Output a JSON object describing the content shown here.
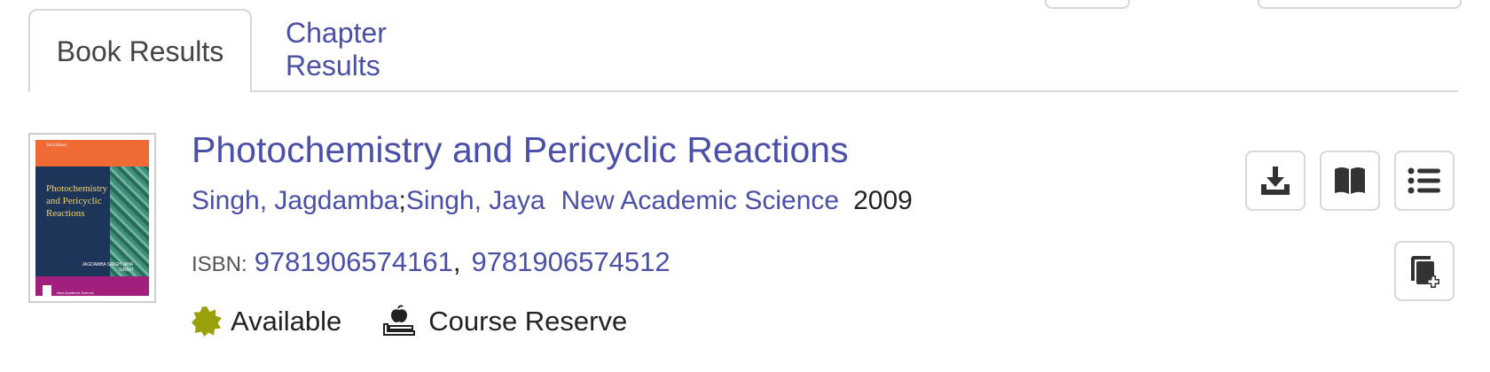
{
  "tabs": [
    {
      "label": "Book Results",
      "active": true
    },
    {
      "label": "Chapter Results",
      "active": false
    }
  ],
  "result": {
    "title": "Photochemistry and Pericyclic Reactions",
    "authors": [
      "Singh, Jagdamba",
      "Singh, Jaya"
    ],
    "author_separator": ";",
    "publisher": "New Academic Science",
    "year": "2009",
    "isbn_label": "ISBN:",
    "isbns": [
      "9781906574161",
      "9781906574512"
    ],
    "isbn_separator": ",",
    "status": "Available",
    "reserve": "Course Reserve",
    "cover": {
      "edition": "3rd Edition",
      "title": "Photochemistry and Pericyclic Reactions",
      "authors": "JAGDAMBA SINGH JAYA SINGH",
      "publisher": "New Academic Science"
    }
  },
  "actions": [
    {
      "icon": "download-icon"
    },
    {
      "icon": "book-open-icon"
    },
    {
      "icon": "list-icon"
    },
    {
      "icon": "add-to-list-icon"
    }
  ],
  "colors": {
    "link": "#4a4fa8",
    "available": "#9aa00c",
    "border": "#d8d8d8"
  }
}
